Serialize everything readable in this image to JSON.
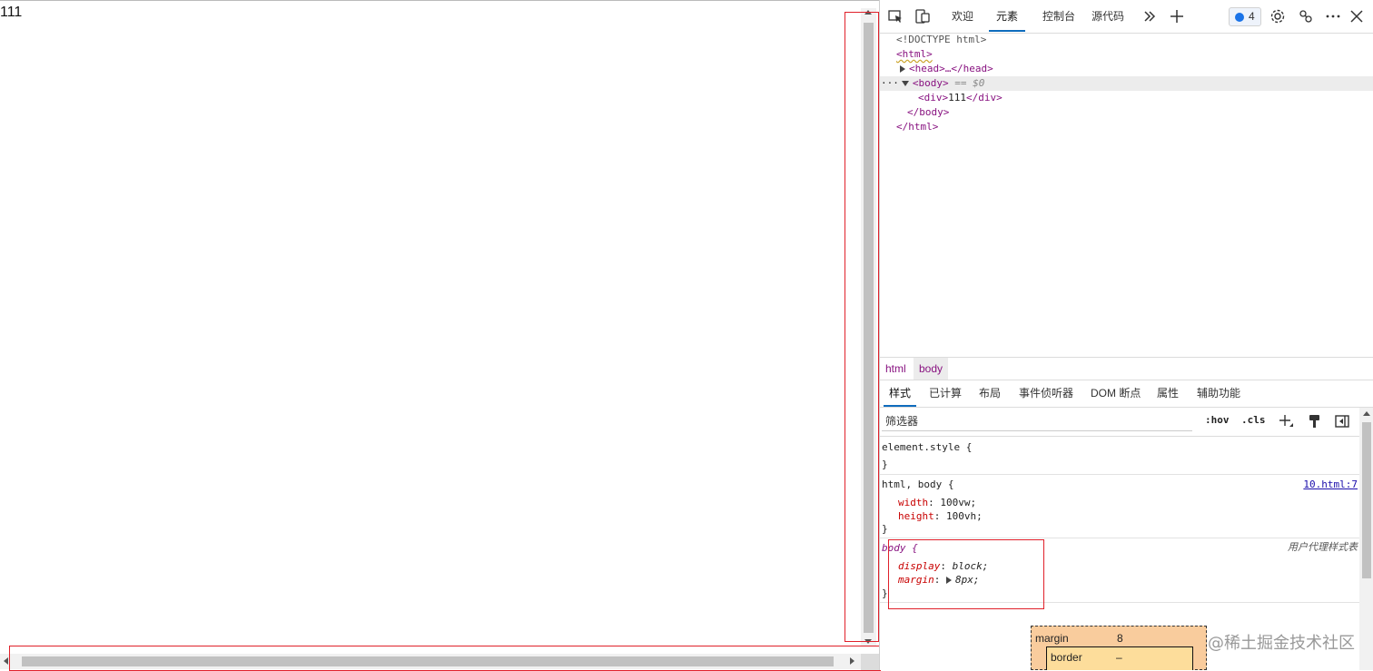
{
  "page": {
    "content_text": "111"
  },
  "devtools": {
    "tabs": [
      {
        "label": "欢迎"
      },
      {
        "label": "元素"
      },
      {
        "label": "控制台"
      },
      {
        "label": "源代码"
      }
    ],
    "issues_count": "4",
    "dom": {
      "doctype": "<!DOCTYPE html>",
      "html_open": "<html>",
      "head_collapsed": "<head>…</head>",
      "body_open": "<body>",
      "body_marker": "== $0",
      "div_open": "<div>",
      "div_text": "111",
      "div_close": "</div>",
      "body_close": "</body>",
      "html_close": "</html>",
      "gutter_dots": "···"
    },
    "breadcrumbs": [
      "html",
      "body"
    ],
    "subtabs": [
      "样式",
      "已计算",
      "布局",
      "事件侦听器",
      "DOM 断点",
      "属性",
      "辅助功能"
    ],
    "filter": {
      "placeholder": "筛选器",
      "hov": ":hov",
      "cls": ".cls"
    },
    "styles": {
      "element_style": {
        "selector": "element.style {",
        "close": "}"
      },
      "rule1": {
        "selector": "html, body {",
        "source": "10.html:7",
        "props": [
          {
            "name": "width",
            "value": "100vw;"
          },
          {
            "name": "height",
            "value": "100vh;"
          }
        ],
        "close": "}"
      },
      "rule2": {
        "selector": "body {",
        "source_label": "用户代理样式表",
        "props": [
          {
            "name": "display",
            "value": "block;"
          },
          {
            "name": "margin",
            "value": "8px;"
          }
        ],
        "close": "}"
      }
    },
    "box_model": {
      "margin_label": "margin",
      "margin_value": "8",
      "border_label": "border",
      "border_value": "–"
    }
  },
  "watermark": "@稀土掘金技术社区",
  "colors": {
    "accent": "#0f6cbd",
    "annotation_red": "#e0202a",
    "tag_purple": "#881280",
    "prop_red": "#c80000"
  }
}
